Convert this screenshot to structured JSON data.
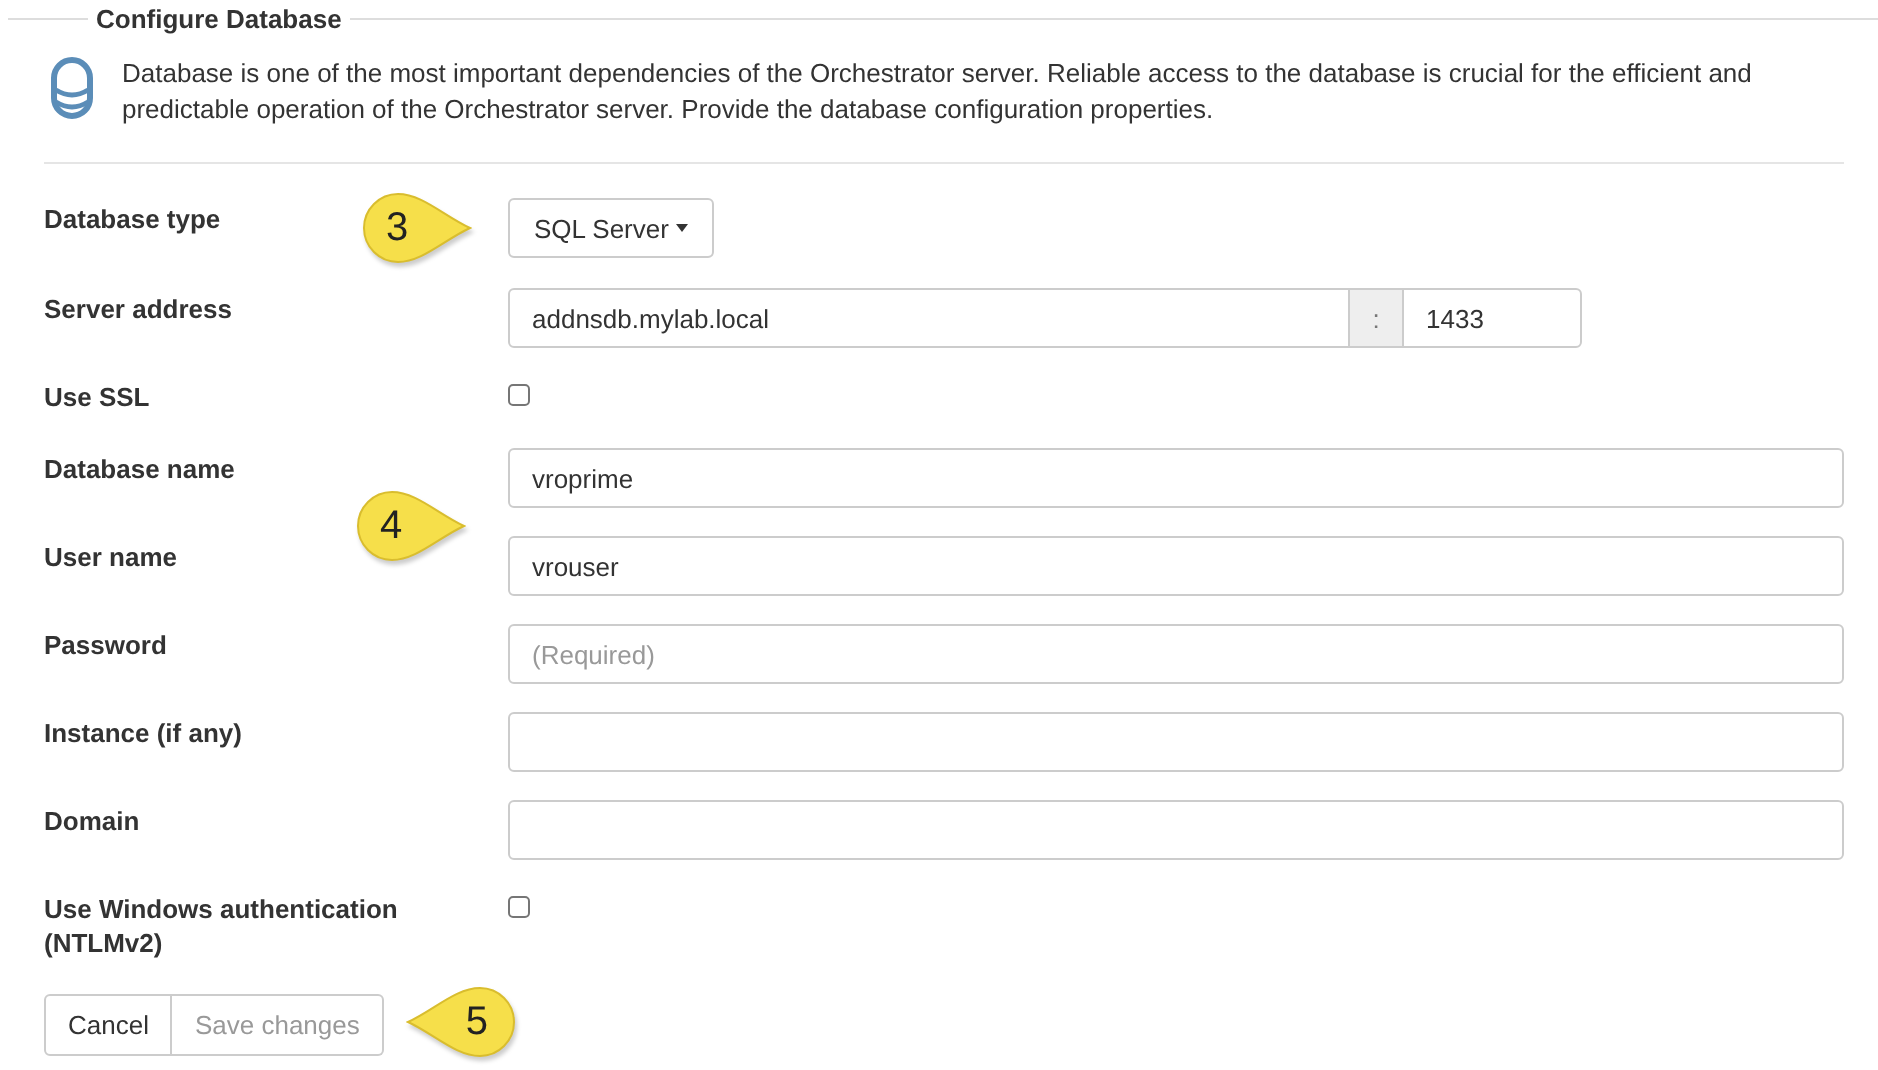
{
  "section": {
    "title": "Configure Database"
  },
  "intro": {
    "text": "Database is one of the most important dependencies of the Orchestrator server. Reliable access to the database is crucial for the efficient and predictable operation of the Orchestrator server. Provide the database configuration properties."
  },
  "fields": [
    {
      "kind": "dropdown",
      "label": "Database type",
      "value": "SQL Server"
    },
    {
      "kind": "host_port",
      "label": "Server address",
      "value": "addnsdb.mylab.local",
      "separator": ":",
      "port": "1433"
    },
    {
      "kind": "checkbox",
      "label": "Use SSL",
      "checked": false
    },
    {
      "kind": "text",
      "label": "Database name",
      "value": "vroprime"
    },
    {
      "kind": "text",
      "label": "User name",
      "value": "vrouser"
    },
    {
      "kind": "text",
      "label": "Password",
      "placeholder": "(Required)"
    },
    {
      "kind": "text",
      "label": "Instance (if any)"
    },
    {
      "kind": "text",
      "label": "Domain"
    },
    {
      "kind": "checkbox",
      "label": "Use Windows authentication (NTLMv2)",
      "checked": false
    }
  ],
  "buttons": [
    {
      "label": "Cancel",
      "disabled": false
    },
    {
      "label": "Save changes",
      "disabled": true
    }
  ],
  "callouts": [
    {
      "text": "3",
      "kind": "right"
    },
    {
      "text": "4",
      "kind": "right"
    },
    {
      "text": "5",
      "kind": "left"
    }
  ]
}
